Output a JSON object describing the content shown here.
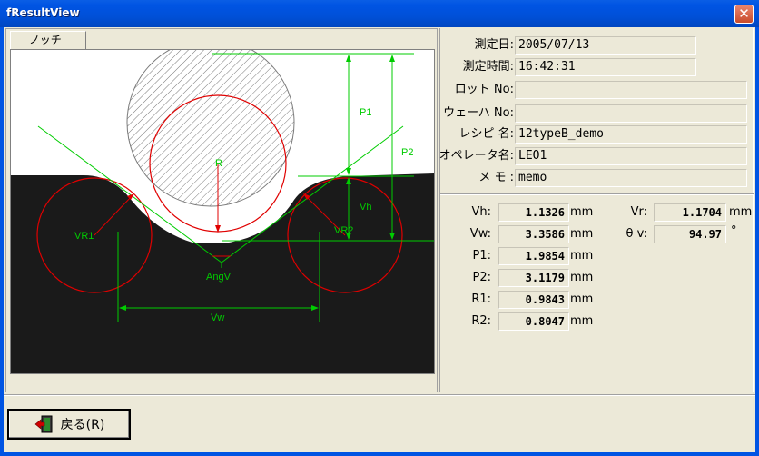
{
  "window": {
    "title": "fResultView",
    "close_glyph": "✕"
  },
  "tab": {
    "label": "ノッチ"
  },
  "diagram": {
    "labels": {
      "p1": "P1",
      "p2": "P2",
      "r": "R",
      "vh": "Vh",
      "vr1": "VR1",
      "vr2": "VR2",
      "angv": "AngV",
      "vw": "Vw"
    },
    "colors": {
      "dimension": "#00cc00",
      "circle": "#e00000",
      "wafer": "#1a1a1a",
      "hatch": "#7a7a7a"
    }
  },
  "info": {
    "date_label": "測定日:",
    "date_value": "2005/07/13",
    "time_label": "測定時間:",
    "time_value": "16:42:31",
    "lot_label": "ロット No:",
    "lot_value": "",
    "wafer_label": "ウェーハ No:",
    "wafer_value": "",
    "recipe_label": "レシピ 名:",
    "recipe_value": "12typeB_demo",
    "operator_label": "オペレータ名:",
    "operator_value": "LEO1",
    "memo_label": "メ モ :",
    "memo_value": "memo"
  },
  "measurements": {
    "vh": {
      "label": "Vh:",
      "value": "1.1326",
      "unit": "mm"
    },
    "vw": {
      "label": "Vw:",
      "value": "3.3586",
      "unit": "mm"
    },
    "p1": {
      "label": "P1:",
      "value": "1.9854",
      "unit": "mm"
    },
    "p2": {
      "label": "P2:",
      "value": "3.1179",
      "unit": "mm"
    },
    "r1": {
      "label": "R1:",
      "value": "0.9843",
      "unit": "mm"
    },
    "r2": {
      "label": "R2:",
      "value": "0.8047",
      "unit": "mm"
    },
    "vr": {
      "label": "Vr:",
      "value": "1.1704",
      "unit": "mm"
    },
    "theta_v": {
      "label": "θ v:",
      "value": "94.97",
      "unit": "°"
    }
  },
  "footer": {
    "back_label": "戻る(R)"
  }
}
